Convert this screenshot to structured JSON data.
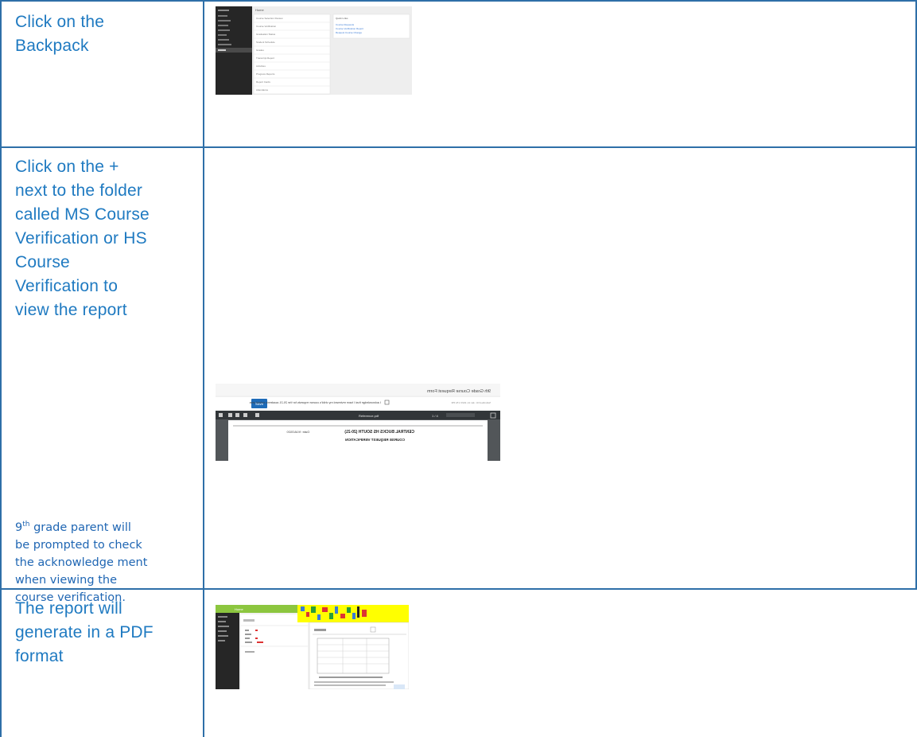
{
  "rows": [
    {
      "step_lines": [
        "Click on the",
        "Backpack"
      ]
    },
    {
      "step_lines": [
        "Click on the +",
        "next to the folder",
        "called MS Course",
        "Verification or HS",
        "Course",
        "Verification to",
        "view the report"
      ],
      "note": {
        "num": "9",
        "sup": "th",
        "lines": [
          " grade parent will",
          "be prompted to  check",
          "the acknowledge ment",
          "when viewing the",
          "course verification."
        ]
      }
    },
    {
      "step_lines": [
        "The report will",
        "generate in a PDF",
        "format"
      ]
    }
  ],
  "screenshots": {
    "backpack": {
      "header_label": "Home",
      "menu_items": [
        "Course Selection Review",
        "Course Verification",
        "Graduation Status",
        "Student Schedule",
        "Grades",
        "Transcript Report",
        "Activities",
        "Progress Reports",
        "Report Cards",
        "Attendance"
      ],
      "side_title": "Quick Links",
      "side_links": [
        "Course Requests",
        "Course Verification Report",
        "Request Course Change"
      ]
    },
    "verification": {
      "title_mirrored": "9th Grade Course Request Form",
      "ack_mirrored": "I acknowledge that I have reviewed my child's course requests for the 20-21 academic school year.",
      "save_label": "Save",
      "date_mirrored": "Submitted On: Jan 14, 2020 1:51 PM",
      "pdf_name": "Reference.pdf",
      "page_counter": "1 / 4",
      "doc_title_mirrored": "CENTRAL BUCKS HS SOUTH (20-21)",
      "doc_subtitle_mirrored": "COURSE REQUEST VERIFICATION",
      "doc_date_mirrored": "Date: 9/18/2020"
    },
    "pdf": {
      "header_label": "Home"
    }
  },
  "colors": {
    "rule": "#2e6fa8",
    "step_text": "#1f7ac1",
    "note_text": "#1f66b3",
    "sidebar": "#262626",
    "save_button": "#1e6bb8",
    "green_header": "#8cc63f"
  }
}
